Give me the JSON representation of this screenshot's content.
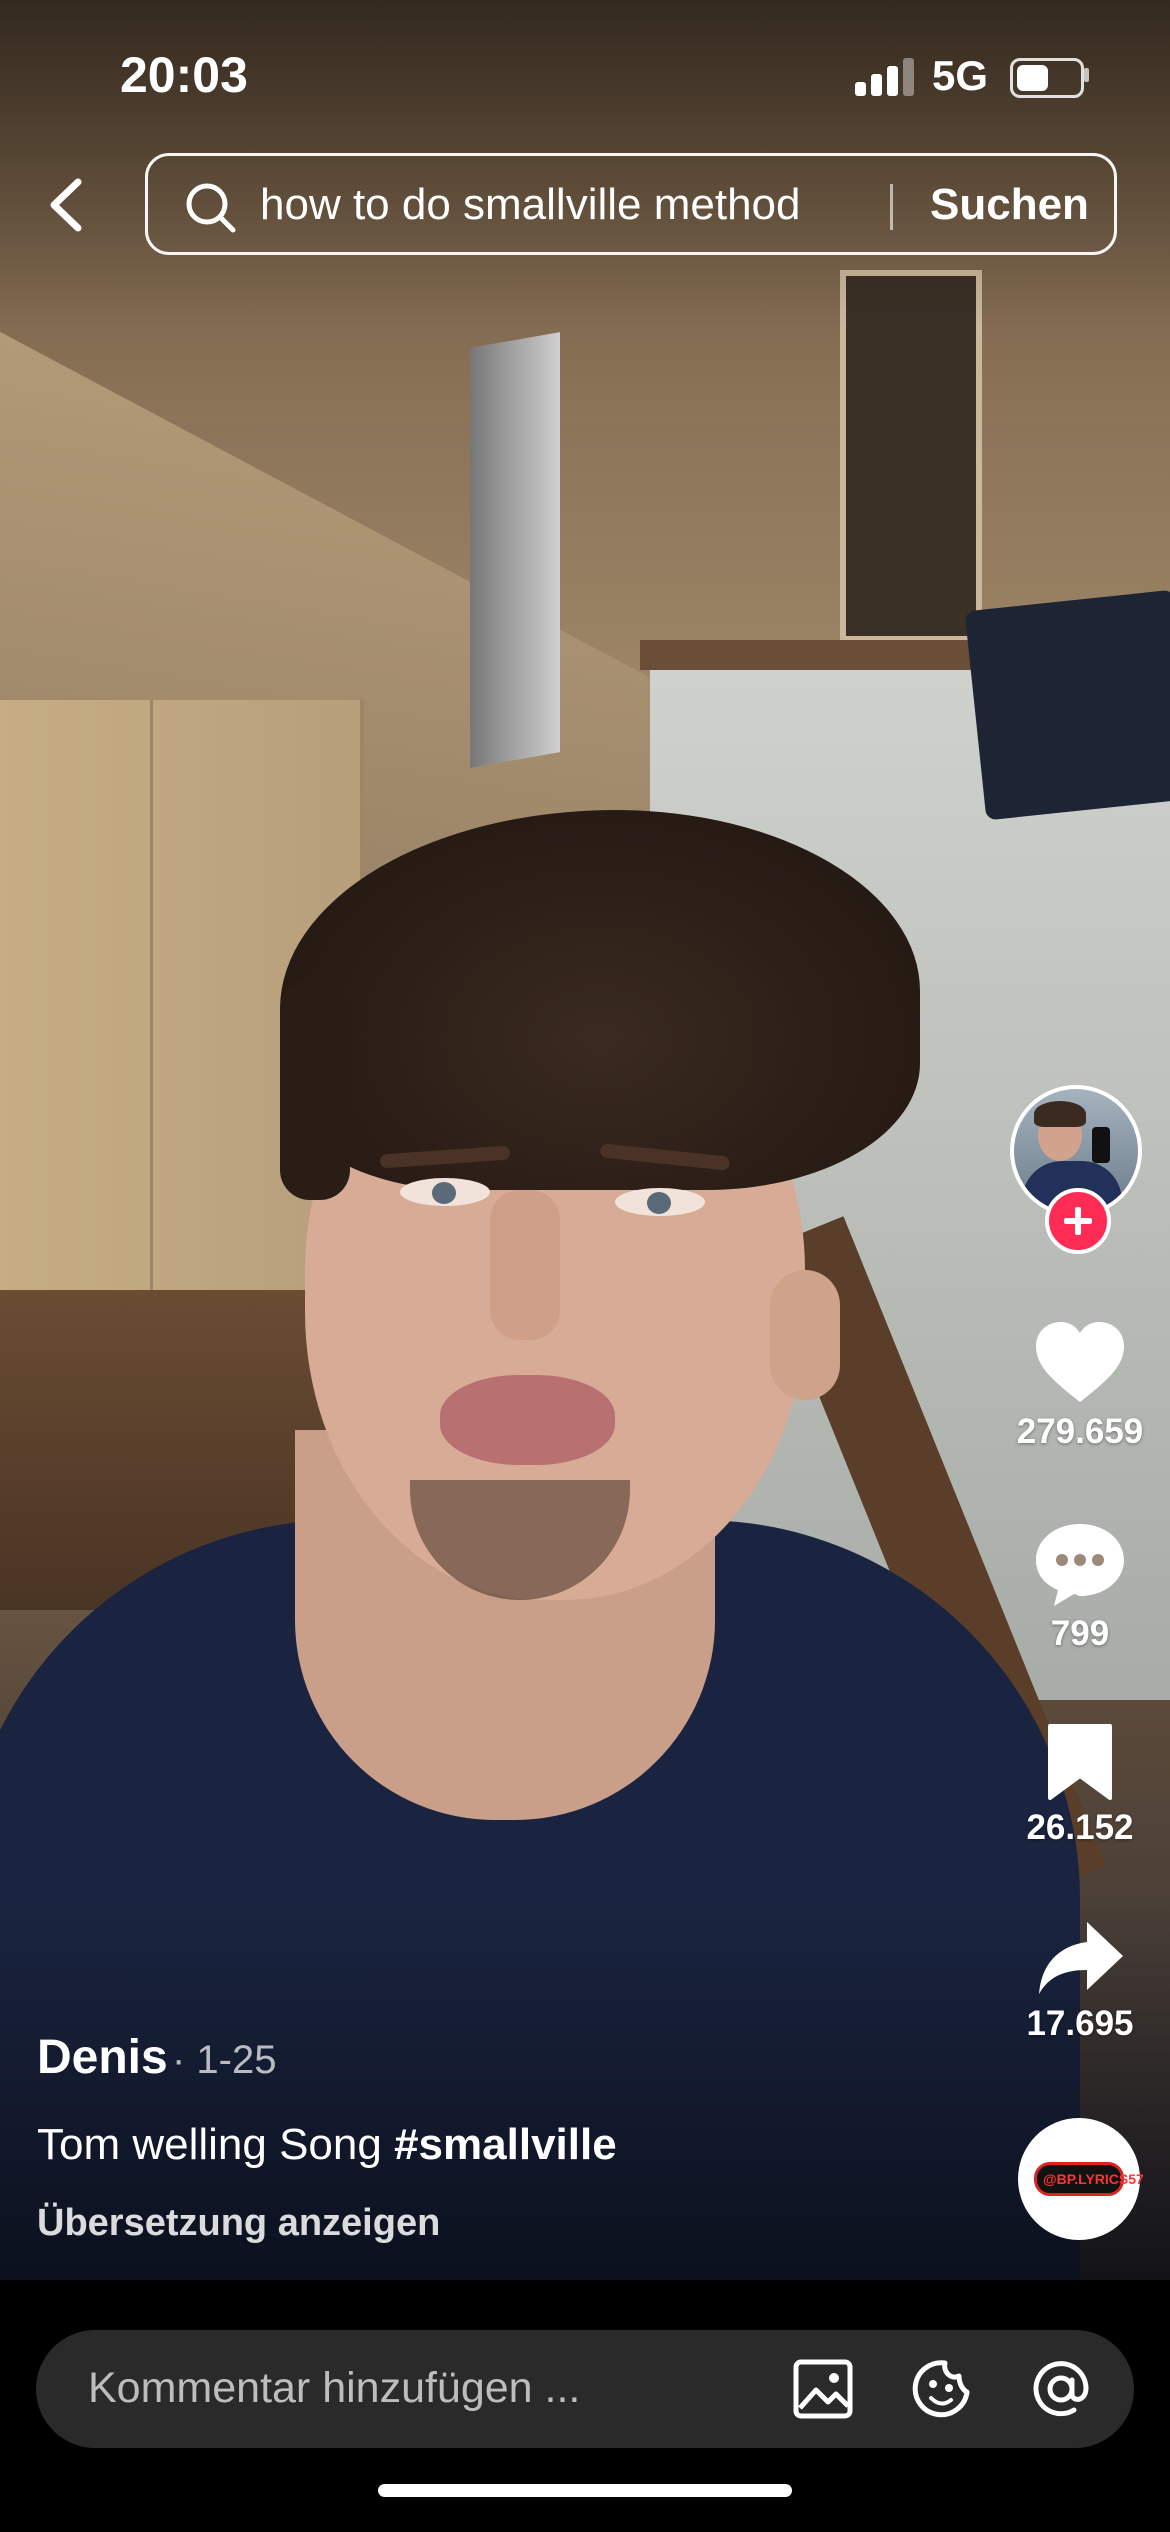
{
  "status_bar": {
    "time": "20:03",
    "network": "5G",
    "battery_level": 0.55,
    "signal_bars": 3
  },
  "search": {
    "query": "how to do smallville method",
    "button_label": "Suchen"
  },
  "actions": {
    "likes": "279.659",
    "comments": "799",
    "bookmarks": "26.152",
    "shares": "17.695"
  },
  "music": {
    "disc_label": "@BP.LYRICS57"
  },
  "post": {
    "author": "Denis",
    "date": "· 1-25",
    "caption_text": "Tom welling Song ",
    "hashtag": "#smallville",
    "translate_label": "Übersetzung anzeigen"
  },
  "comment_bar": {
    "placeholder": "Kommentar hinzufügen ..."
  },
  "colors": {
    "follow_accent": "#fe2c55",
    "bottom_bar": "#000000",
    "comment_field": "#2a2a2a"
  },
  "icons": [
    "back-icon",
    "search-icon",
    "heart-icon",
    "comment-icon",
    "bookmark-icon",
    "share-icon",
    "image-icon",
    "emoji-icon",
    "mention-icon",
    "plus-icon"
  ]
}
